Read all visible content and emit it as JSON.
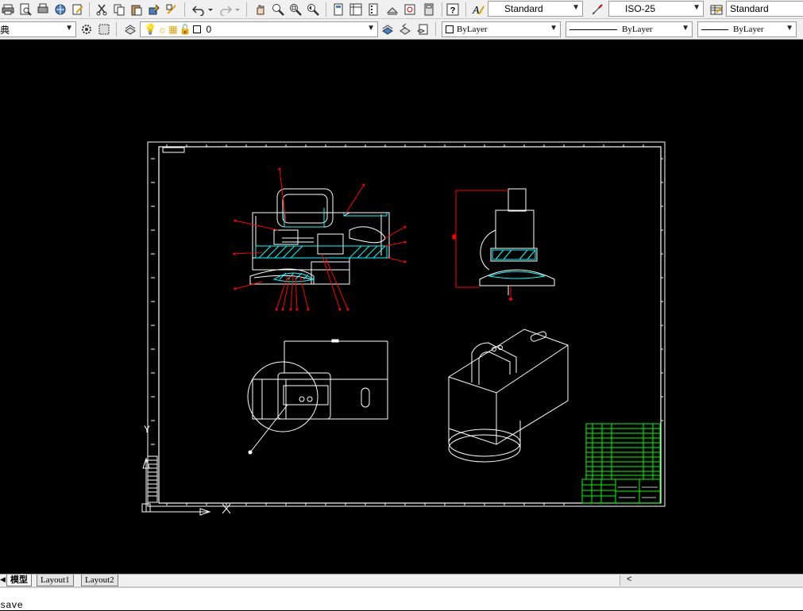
{
  "toolbar1": {
    "text_style": "Standard",
    "dim_style": "ISO-25",
    "table_style": "Standard"
  },
  "toolbar2": {
    "workspace": "典",
    "layer": "0",
    "color": "ByLayer",
    "linetype": "ByLayer",
    "lineweight": "ByLayer"
  },
  "tabs": [
    {
      "label": "模型"
    },
    {
      "label": "Layout1"
    },
    {
      "label": "Layout2"
    }
  ],
  "scroll_arrow": "<",
  "command_line": {
    "text": "save"
  },
  "drawing": {
    "background": "#000000",
    "frame_color": "#ffffff",
    "section_color": "#00ffff",
    "leader_color": "#ff0000",
    "title_block_color": "#00ff00",
    "ucs_labels": {
      "y": "Y",
      "x": "X"
    }
  }
}
